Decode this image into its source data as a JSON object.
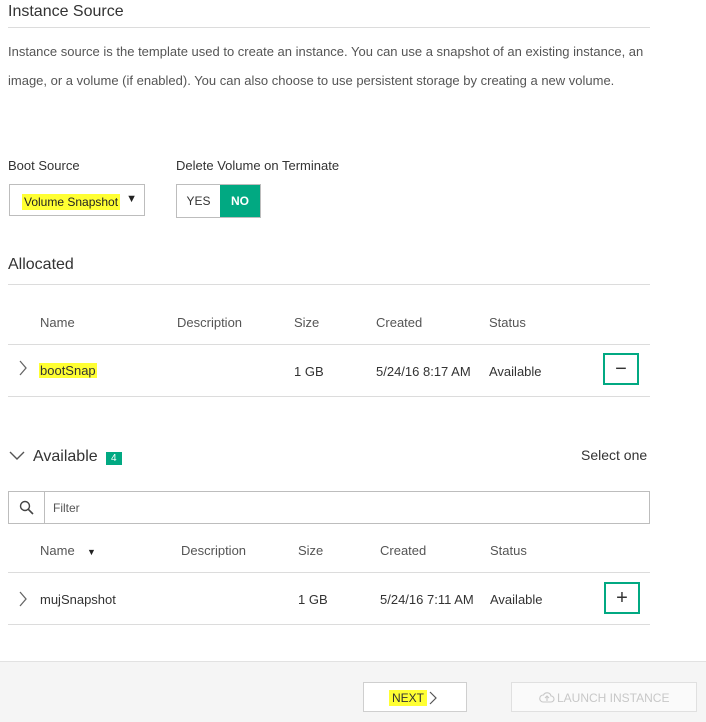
{
  "section": {
    "title": "Instance Source",
    "description": "Instance source is the template used to create an instance. You can use a snapshot of an existing instance, an image, or a volume (if enabled). You can also choose to use persistent storage by creating a new volume."
  },
  "boot_source": {
    "label": "Boot Source",
    "selected": "Volume Snapshot"
  },
  "delete_volume": {
    "label": "Delete Volume on Terminate",
    "yes": "YES",
    "no": "NO",
    "active": "NO"
  },
  "allocated": {
    "title": "Allocated",
    "columns": [
      "Name",
      "Description",
      "Size",
      "Created",
      "Status"
    ],
    "rows": [
      {
        "name": "bootSnap",
        "description": "",
        "size": "1 GB",
        "created": "5/24/16 8:17 AM",
        "status": "Available",
        "action": "−"
      }
    ]
  },
  "available": {
    "title": "Available",
    "count": "4",
    "select_hint": "Select one",
    "filter_placeholder": "Filter",
    "columns": [
      "Name",
      "Description",
      "Size",
      "Created",
      "Status"
    ],
    "sort_indicator": "▼",
    "rows": [
      {
        "name": "mujSnapshot",
        "description": "",
        "size": "1 GB",
        "created": "5/24/16 7:11 AM",
        "status": "Available",
        "action": "+"
      }
    ]
  },
  "footer": {
    "next_label": "NEXT",
    "launch_label": "LAUNCH INSTANCE"
  },
  "colors": {
    "accent": "#01a982",
    "highlight": "#ffff33"
  },
  "icons": [
    "chevron-right-icon",
    "chevron-down-icon",
    "search-icon",
    "cloud-upload-icon",
    "minus-icon",
    "plus-icon",
    "caret-down-icon"
  ]
}
